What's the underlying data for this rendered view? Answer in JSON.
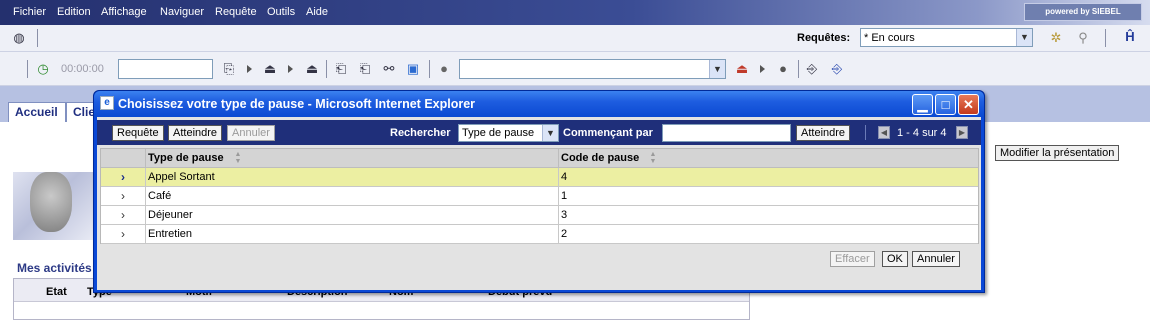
{
  "menubar": {
    "items": [
      "Fichier",
      "Edition",
      "Affichage",
      "Naviguer",
      "Requête",
      "Outils",
      "Aide"
    ],
    "brand": "powered by SIEBEL"
  },
  "toolbar1": {
    "requetes_label": "Requêtes:",
    "requetes_value": "* En cours"
  },
  "toolbar2": {
    "timer": "00:00:00",
    "text_value": "",
    "combo_value": ""
  },
  "tabs": [
    "Accueil",
    "Clie"
  ],
  "page": {
    "modify_button": "Modifier la présentation",
    "section_title": "Mes activités",
    "grid_headers": [
      "Etat",
      "Type",
      "Motif",
      "Description",
      "Nom",
      "Début prévu"
    ]
  },
  "dialog": {
    "title": "Choisissez votre type de pause - Microsoft Internet Explorer",
    "toolbar": {
      "query_button": "Requête",
      "goto_button": "Atteindre",
      "cancel_button": "Annuler",
      "search_label": "Rechercher",
      "search_field_value": "Type de pause",
      "starting_with_label": "Commençant par",
      "starting_with_value": "",
      "goto_button2": "Atteindre",
      "record_count": "1 - 4 sur 4"
    },
    "columns": [
      "Type de pause",
      "Code de pause"
    ],
    "rows": [
      {
        "type": "Appel Sortant",
        "code": "4",
        "selected": true
      },
      {
        "type": "Café",
        "code": "1",
        "selected": false
      },
      {
        "type": "Déjeuner",
        "code": "3",
        "selected": false
      },
      {
        "type": "Entretien",
        "code": "2",
        "selected": false
      }
    ],
    "footer": {
      "clear_button": "Effacer",
      "ok_button": "OK",
      "cancel_button": "Annuler"
    }
  },
  "colors": {
    "selected_row": "#ecefa2",
    "dialog_title": "#0a49d2",
    "dialog_toolbar": "#1f2f7a",
    "nav_band": "#b6c1e2"
  }
}
